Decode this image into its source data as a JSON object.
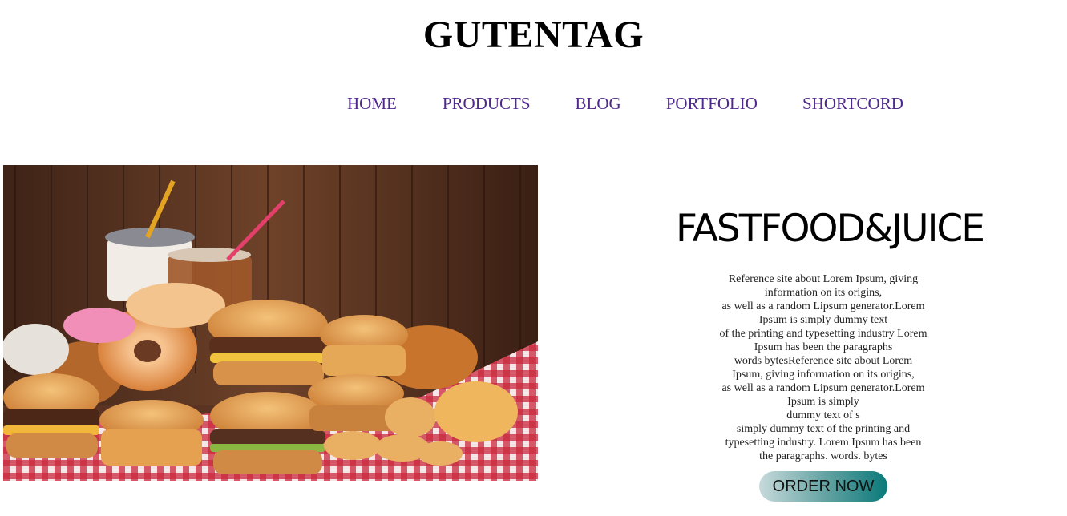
{
  "header": {
    "site_title": "GUTENTAG"
  },
  "nav": {
    "items": [
      {
        "label": "HOME"
      },
      {
        "label": "PRODUCTS"
      },
      {
        "label": "BLOG"
      },
      {
        "label": "PORTFOLIO"
      },
      {
        "label": "SHORTCORD"
      }
    ],
    "link_color": "#4f2a8c"
  },
  "hero": {
    "image_subject": "fast-food burgers, donuts, fried chicken and drinks on red-checkered tablecloth"
  },
  "main": {
    "headline": "FASTFOOD&JUICE",
    "description_lines": [
      "Reference site about Lorem Ipsum, giving",
      "information on its origins,",
      "as well as a random Lipsum generator.Lorem",
      "Ipsum is simply dummy text",
      "of the printing and typesetting industry Lorem",
      "Ipsum has been the paragraphs",
      "words bytesReference site about Lorem",
      "Ipsum, giving information on its origins,",
      "as well as a random Lipsum generator.Lorem",
      "Ipsum is simply",
      "dummy text of s",
      "simply dummy text of the printing and",
      "typesetting industry. Lorem Ipsum has been",
      "the paragraphs. words. bytes"
    ],
    "order_button_label": "ORDER NOW",
    "button_gradient": [
      "#c7dadb",
      "#5e9f9f",
      "#0a7a7a"
    ]
  }
}
